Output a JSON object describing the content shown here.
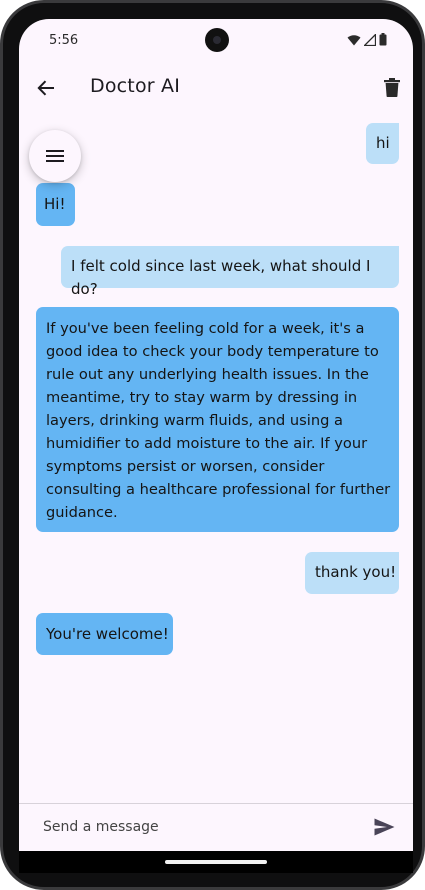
{
  "status_bar": {
    "time": "5:56"
  },
  "app_bar": {
    "title": "Doctor AI"
  },
  "icons": {
    "back": "arrow-left-icon",
    "delete": "trash-icon",
    "menu": "hamburger-menu-icon",
    "send": "send-icon"
  },
  "colors": {
    "background": "#fdf6fe",
    "user_bubble": "#bcdff8",
    "bot_bubble": "#64b5f3"
  },
  "messages": [
    {
      "sender": "user",
      "text": "hi"
    },
    {
      "sender": "bot",
      "text": "Hi!"
    },
    {
      "sender": "user",
      "text": "I felt cold since last week, what should I do?"
    },
    {
      "sender": "bot",
      "text": "If you've been feeling cold for a week, it's a\ngood idea to check your body temperature to\nrule out any underlying health issues. In the\nmeantime, try to stay warm by dressing in\nlayers, drinking warm fluids, and using a\nhumidifier to add moisture to the air. If your\nsymptoms persist or worsen, consider\nconsulting a healthcare professional for further\nguidance."
    },
    {
      "sender": "user",
      "text": "thank you!"
    },
    {
      "sender": "bot",
      "text": "You're welcome!"
    }
  ],
  "composer": {
    "placeholder": "Send a message",
    "value": ""
  }
}
